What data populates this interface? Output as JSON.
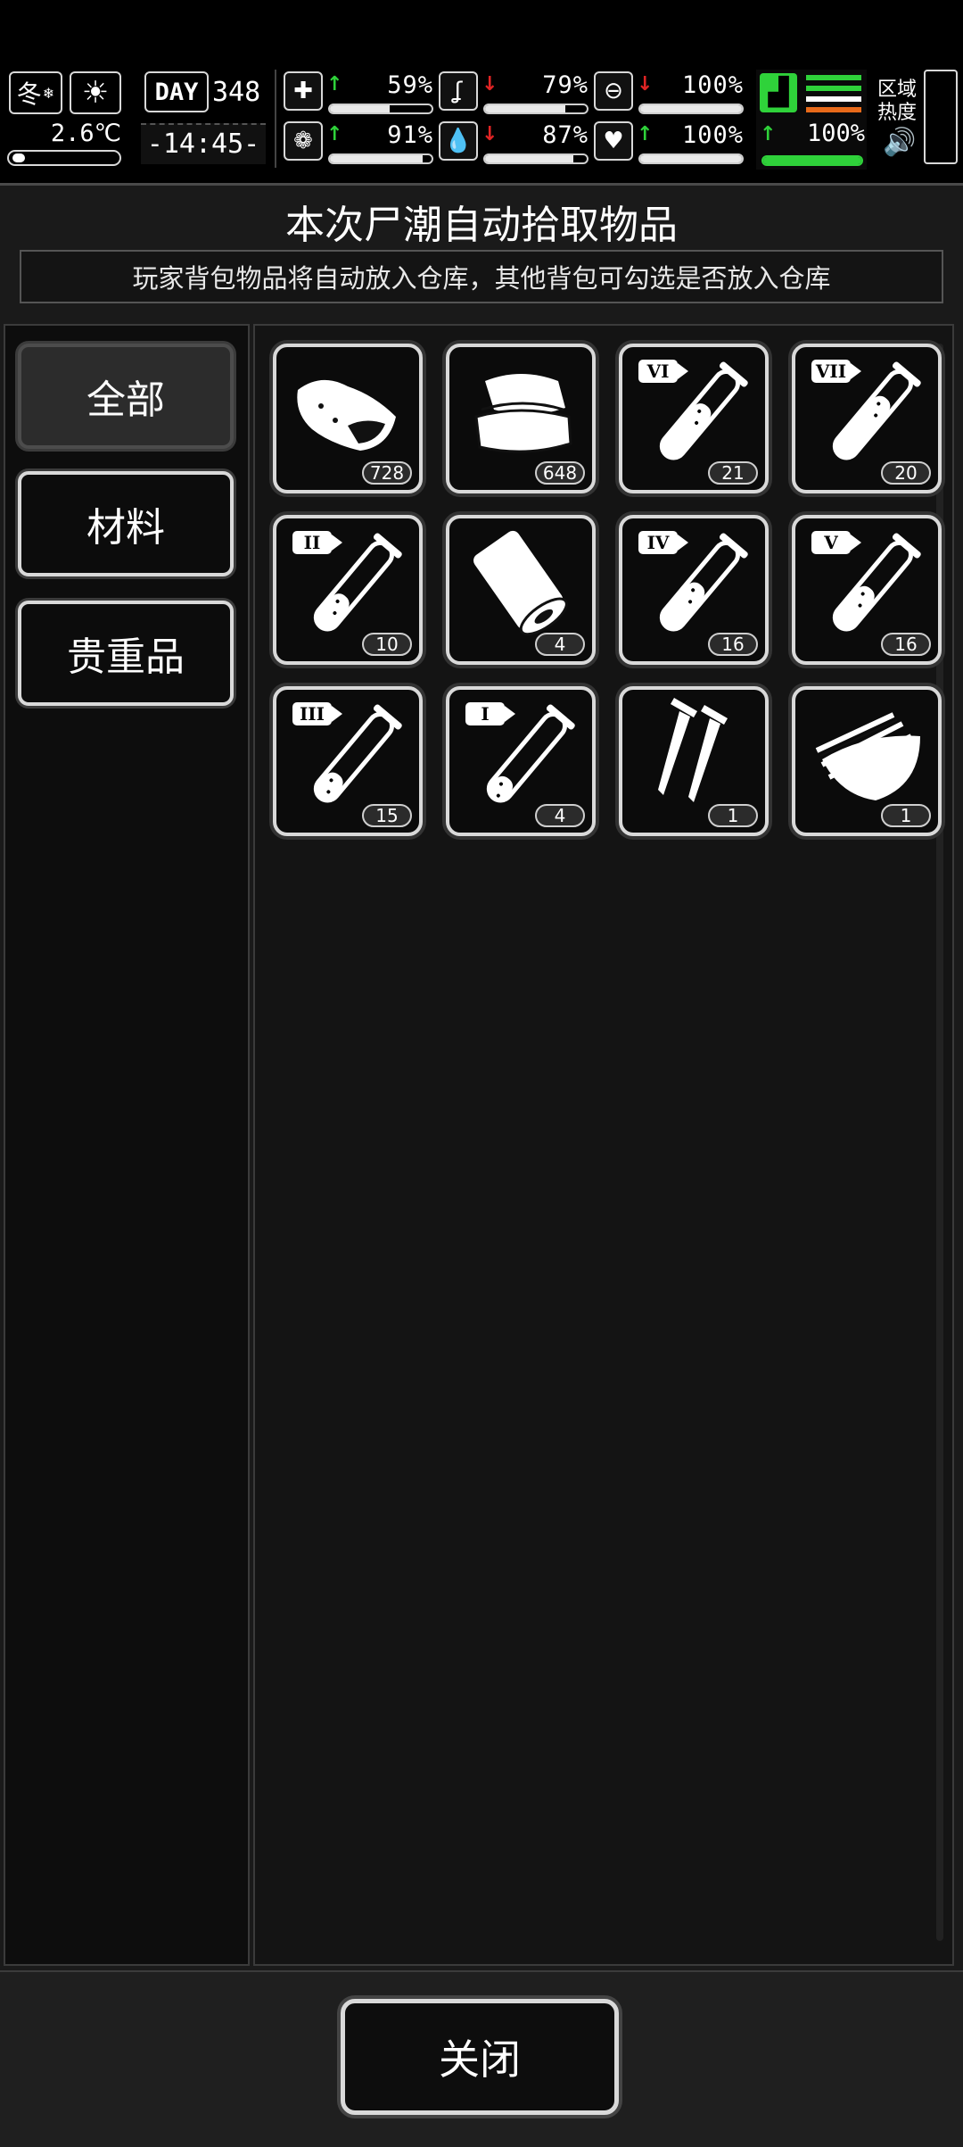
{
  "hud": {
    "season": "冬",
    "weather_icon": "sun-icon",
    "temperature": "2.6℃",
    "day_label": "DAY",
    "day_number": "348",
    "clock": "-14:45-",
    "stats": [
      {
        "icon": "medkit-icon",
        "trend": "up",
        "value": "59%",
        "level": 0.59
      },
      {
        "icon": "stomach-icon",
        "trend": "down",
        "value": "79%",
        "level": 0.79
      },
      {
        "icon": "pill-icon",
        "trend": "down",
        "value": "100%",
        "level": 1.0
      },
      {
        "icon": "brain-icon",
        "trend": "up",
        "value": "91%",
        "level": 0.91
      },
      {
        "icon": "water-drop-icon",
        "trend": "down",
        "value": "87%",
        "level": 0.87
      },
      {
        "icon": "heart-icon",
        "trend": "up",
        "value": "100%",
        "level": 1.0
      }
    ],
    "stamina": {
      "icon": "boot-icon",
      "trend": "up",
      "value": "100%",
      "level": 1.0
    },
    "zone_heat_label": "区域热度",
    "sound_icon": "speaker-icon"
  },
  "panel": {
    "title": "本次尸潮自动拾取物品",
    "subtitle": "玩家背包物品将自动放入仓库，其他背包可勾选是否放入仓库"
  },
  "categories": [
    {
      "label": "全部",
      "active": true
    },
    {
      "label": "材料",
      "active": false
    },
    {
      "label": "贵重品",
      "active": false
    }
  ],
  "items": [
    {
      "icon": "meat-chunk-icon",
      "count": "728"
    },
    {
      "icon": "cloth-stack-icon",
      "count": "648"
    },
    {
      "icon": "test-tube-vi-icon",
      "tier": "VI",
      "count": "21"
    },
    {
      "icon": "test-tube-vii-icon",
      "tier": "VII",
      "count": "20"
    },
    {
      "icon": "test-tube-ii-icon",
      "tier": "II",
      "count": "10"
    },
    {
      "icon": "bandage-roll-icon",
      "count": "4"
    },
    {
      "icon": "test-tube-iv-icon",
      "tier": "IV",
      "count": "16"
    },
    {
      "icon": "test-tube-v-icon",
      "tier": "V",
      "count": "16"
    },
    {
      "icon": "test-tube-iii-icon",
      "tier": "III",
      "count": "15"
    },
    {
      "icon": "test-tube-i-icon",
      "tier": "I",
      "count": "4"
    },
    {
      "icon": "screws-icon",
      "count": "1"
    },
    {
      "icon": "scrap-metal-icon",
      "count": "1"
    }
  ],
  "footer": {
    "close_label": "关闭"
  },
  "colors": {
    "up": "#2fd23a",
    "down": "#e02424",
    "stamina_green": "#2fd23a",
    "stamina_orange": "#e86a1a"
  }
}
